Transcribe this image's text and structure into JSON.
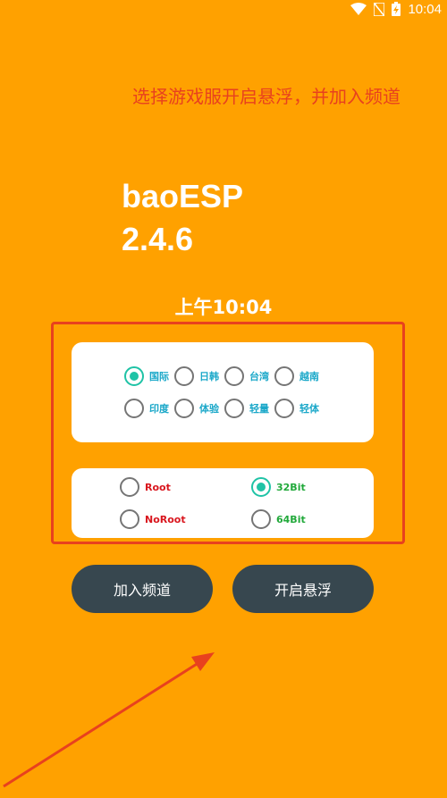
{
  "status_bar": {
    "time": "10:04",
    "icons": [
      "wifi-icon",
      "no-sim-icon",
      "battery-charging-icon"
    ]
  },
  "hint": "选择游戏服开启悬浮，并加入频道",
  "app": {
    "name": "baoESP",
    "version": "2.4.6",
    "clock": "上午10:04"
  },
  "server_options": [
    {
      "label": "国际",
      "checked": true
    },
    {
      "label": "日韩",
      "checked": false
    },
    {
      "label": "台湾",
      "checked": false
    },
    {
      "label": "越南",
      "checked": false
    },
    {
      "label": "印度",
      "checked": false
    },
    {
      "label": "体验",
      "checked": false
    },
    {
      "label": "轻量",
      "checked": false
    },
    {
      "label": "轻体",
      "checked": false
    }
  ],
  "root_options": [
    {
      "label": "Root",
      "checked": false
    },
    {
      "label": "NoRoot",
      "checked": false
    }
  ],
  "bit_options": [
    {
      "label": "32Bit",
      "checked": true
    },
    {
      "label": "64Bit",
      "checked": false
    }
  ],
  "buttons": {
    "join_channel": "加入频道",
    "open_float": "开启悬浮"
  },
  "colors": {
    "background": "#FFA100",
    "annotation_red": "#E8411E",
    "button_dark": "#37474F",
    "radio_checked": "#1FC3A6"
  }
}
